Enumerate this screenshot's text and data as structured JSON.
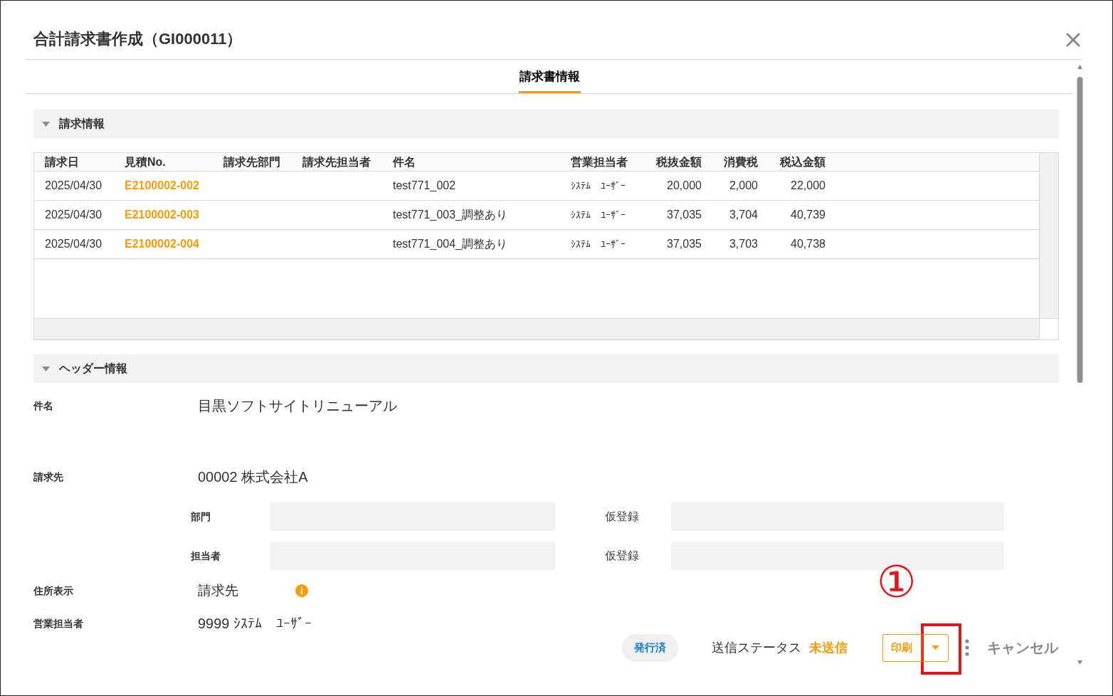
{
  "dialog": {
    "title": "合計請求書作成（GI000011）"
  },
  "tabs": [
    {
      "label": "請求書情報",
      "selected": true
    }
  ],
  "sections": [
    {
      "kind": "table",
      "title": "請求情報",
      "expanded": true,
      "table": {
        "columns": [
          {
            "label": "請求日",
            "kind": "text"
          },
          {
            "label": "見積No.",
            "kind": "link"
          },
          {
            "label": "請求先部門",
            "kind": "text"
          },
          {
            "label": "請求先担当者",
            "kind": "text"
          },
          {
            "label": "件名",
            "kind": "text"
          },
          {
            "label": "営業担当者",
            "kind": "narrow"
          },
          {
            "label": "税抜金額",
            "kind": "amount"
          },
          {
            "label": "消費税",
            "kind": "amount"
          },
          {
            "label": "税込金額",
            "kind": "amount"
          }
        ],
        "rows": [
          {
            "cells": [
              "2025/04/30",
              "E2100002-002",
              null,
              null,
              "test771_002",
              "ｼｽﾃﾑ　ﾕｰｻﾞｰ",
              "20,000",
              "2,000",
              "22,000"
            ]
          },
          {
            "cells": [
              "2025/04/30",
              "E2100002-003",
              null,
              null,
              "test771_003_調整あり",
              "ｼｽﾃﾑ　ﾕｰｻﾞｰ",
              "37,035",
              "3,704",
              "40,739"
            ]
          },
          {
            "cells": [
              "2025/04/30",
              "E2100002-004",
              null,
              null,
              "test771_004_調整あり",
              "ｼｽﾃﾑ　ﾕｰｻﾞｰ",
              "37,035",
              "3,703",
              "40,738"
            ]
          }
        ]
      }
    },
    {
      "kind": "form",
      "title": "ヘッダー情報",
      "expanded": true,
      "fields": [
        {
          "kind": "text",
          "label": "件名",
          "value": "目黒ソフトサイトリニューアル"
        },
        {
          "kind": "party",
          "label": "請求先",
          "value": "00002 株式会社A",
          "sub_fields": [
            {
              "label": "部門",
              "secondary_label": "仮登録"
            },
            {
              "label": "担当者",
              "secondary_label": "仮登録"
            }
          ]
        },
        {
          "kind": "info",
          "label": "住所表示",
          "value": "請求先"
        },
        {
          "kind": "text",
          "label": "営業担当者",
          "value": "9999 ｼｽﾃﾑ　ﾕｰｻﾞｰ"
        }
      ]
    }
  ],
  "footer": {
    "issue_status": "発行済",
    "send_status_label": "送信ステータス",
    "send_status": "未送信",
    "print_button": "印刷",
    "cancel_button": "キャンセル"
  },
  "annotation": {
    "label": "①"
  }
}
